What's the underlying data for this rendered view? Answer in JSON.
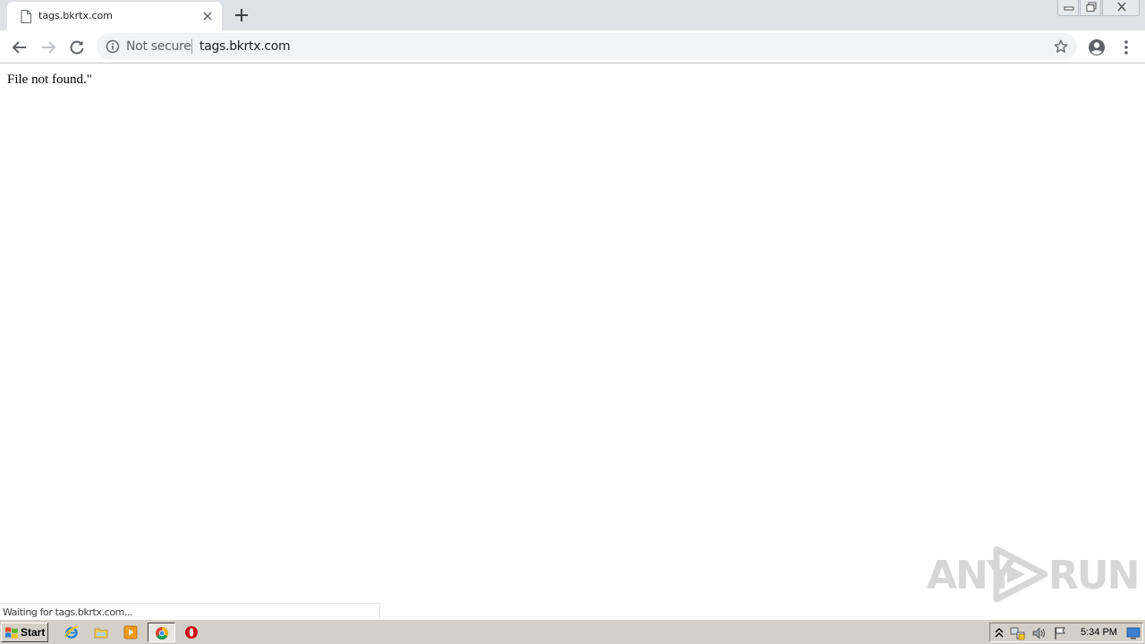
{
  "browser": {
    "tab": {
      "title": "tags.bkrtx.com",
      "icon": "page-icon"
    },
    "window_controls": [
      "minimize-icon",
      "restore-icon",
      "close-icon"
    ],
    "toolbar": {
      "security_label": "Not secure",
      "url": "tags.bkrtx.com",
      "icons": [
        "back-arrow-icon",
        "forward-arrow-icon",
        "reload-icon",
        "info-icon",
        "star-icon",
        "profile-icon",
        "menu-dots-icon"
      ]
    }
  },
  "page": {
    "body_text": "File not found.\""
  },
  "status_bubble": "Waiting for tags.bkrtx.com...",
  "watermark": {
    "left": "ANY",
    "right": "RUN"
  },
  "taskbar": {
    "start_label": "Start",
    "apps": [
      "internet-explorer-icon",
      "windows-explorer-icon",
      "media-player-icon",
      "chrome-icon",
      "opera-icon"
    ],
    "active_app": "chrome-icon",
    "tray_icons": [
      "show-hidden-icons-arrow",
      "network-icon",
      "volume-icon",
      "action-center-flag-icon"
    ],
    "clock": "5:34 PM"
  },
  "colors": {
    "tabstrip_bg": "#dee1e6",
    "omnibox_bg": "#f1f3f4",
    "taskbar_bg": "#d4d0c8",
    "icon_gray": "#5f6368"
  }
}
